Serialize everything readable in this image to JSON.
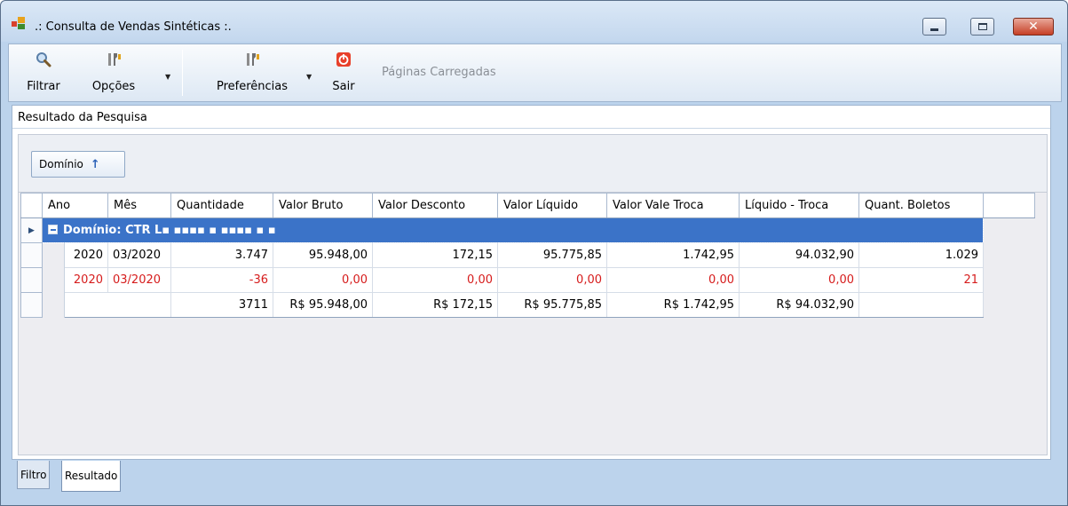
{
  "window": {
    "title": ".: Consulta de Vendas Sintéticas :."
  },
  "toolbar": {
    "filter_label": "Filtrar",
    "options_label": "Opções",
    "preferences_label": "Preferências",
    "exit_label": "Sair",
    "pages_loaded_label": "Páginas Carregadas"
  },
  "panel": {
    "title": "Resultado da Pesquisa",
    "group_chip_label": "Domínio"
  },
  "grid": {
    "columns": [
      "Ano",
      "Mês",
      "Quantidade",
      "Valor Bruto",
      "Valor Desconto",
      "Valor Líquido",
      "Valor Vale Troca",
      "Líquido - Troca",
      "Quant. Boletos"
    ],
    "group_label": "Domínio: CTR L▪ ▪▪▪▪ ▪ ▪▪▪▪ ▪ ▪",
    "rows": [
      {
        "ano": "2020",
        "mes": "03/2020",
        "quantidade": "3.747",
        "valor_bruto": "95.948,00",
        "valor_desconto": "172,15",
        "valor_liquido": "95.775,85",
        "valor_vale_troca": "1.742,95",
        "liquido_troca": "94.032,90",
        "quant_boletos": "1.029"
      },
      {
        "ano": "2020",
        "mes": "03/2020",
        "quantidade": "-36",
        "valor_bruto": "0,00",
        "valor_desconto": "0,00",
        "valor_liquido": "0,00",
        "valor_vale_troca": "0,00",
        "liquido_troca": "0,00",
        "quant_boletos": "21"
      }
    ],
    "summary": {
      "quantidade": "3711",
      "valor_bruto": "R$ 95.948,00",
      "valor_desconto": "R$ 172,15",
      "valor_liquido": "R$ 95.775,85",
      "valor_vale_troca": "R$ 1.742,95",
      "liquido_troca": "R$ 94.032,90"
    }
  },
  "tabs": [
    {
      "label": "Filtro",
      "active": false
    },
    {
      "label": "Resultado",
      "active": true
    }
  ],
  "colors": {
    "group_row": "#3b73c8",
    "negative_text": "#d61c1c",
    "window_frame": "#bcd3ec"
  },
  "icons": {
    "app": "app-windows-icon",
    "filter": "magnifier-icon",
    "options": "tools-icon",
    "preferences": "tools-icon",
    "exit": "power-icon"
  }
}
